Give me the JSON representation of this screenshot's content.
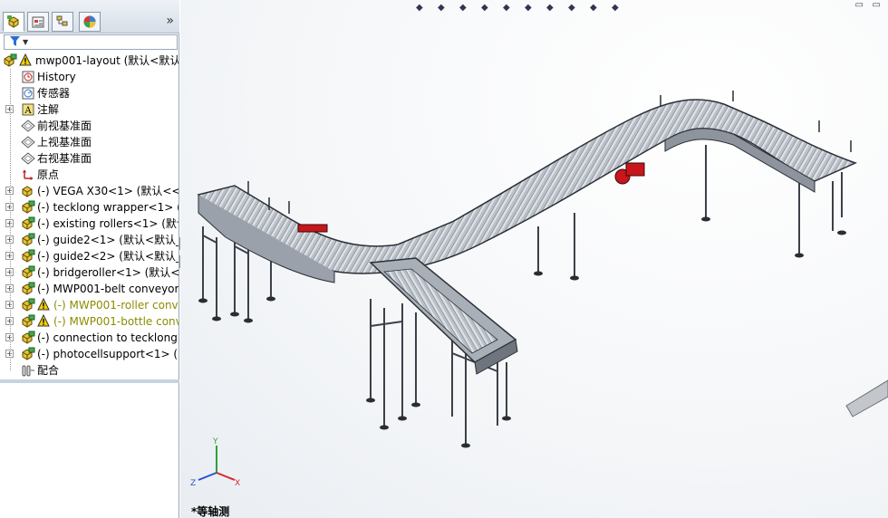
{
  "panel": {
    "tabs": [
      {
        "name": "feature-manager-tab",
        "icon": "feature-tree-icon"
      },
      {
        "name": "property-manager-tab",
        "icon": "property-icon"
      },
      {
        "name": "configuration-manager-tab",
        "icon": "configuration-icon"
      },
      {
        "name": "display-manager-tab",
        "icon": "display-manager-icon"
      }
    ],
    "more_tabs": "»",
    "filter_icon": "filter-icon"
  },
  "tree": [
    {
      "label": "mwp001-layout  (默认<默认",
      "icon": "assembly-icon",
      "level": 0,
      "expander": false,
      "warning": true,
      "warn_color": false
    },
    {
      "label": "History",
      "icon": "history-icon",
      "level": 1,
      "expander": false
    },
    {
      "label": "传感器",
      "icon": "sensor-icon",
      "level": 1,
      "expander": false
    },
    {
      "label": "注解",
      "icon": "annotation-icon",
      "level": 1,
      "expander": true
    },
    {
      "label": "前视基准面",
      "icon": "plane-icon",
      "level": 1,
      "expander": false
    },
    {
      "label": "上视基准面",
      "icon": "plane-icon",
      "level": 1,
      "expander": false
    },
    {
      "label": "右视基准面",
      "icon": "plane-icon",
      "level": 1,
      "expander": false
    },
    {
      "label": "原点",
      "icon": "origin-icon",
      "level": 1,
      "expander": false
    },
    {
      "label": "(-) VEGA X30<1> (默认<<默",
      "icon": "part-icon",
      "level": 1,
      "expander": true
    },
    {
      "label": "(-) tecklong wrapper<1> (",
      "icon": "subassembly-icon",
      "level": 1,
      "expander": true
    },
    {
      "label": "(-) existing rollers<1> (默认",
      "icon": "subassembly-icon",
      "level": 1,
      "expander": true
    },
    {
      "label": "(-) guide2<1> (默认<默认_",
      "icon": "subassembly-icon",
      "level": 1,
      "expander": true
    },
    {
      "label": "(-) guide2<2> (默认<默认_",
      "icon": "subassembly-icon",
      "level": 1,
      "expander": true
    },
    {
      "label": "(-) bridgeroller<1> (默认<",
      "icon": "subassembly-icon",
      "level": 1,
      "expander": true
    },
    {
      "label": "(-) MWP001-belt conveyor",
      "icon": "subassembly-icon",
      "level": 1,
      "expander": true
    },
    {
      "label": "(-) MWP001-roller conv",
      "icon": "subassembly-icon",
      "level": 1,
      "expander": true,
      "warning": true,
      "warn_color": true
    },
    {
      "label": "(-) MWP001-bottle conv",
      "icon": "subassembly-icon",
      "level": 1,
      "expander": true,
      "warning": true,
      "warn_color": true
    },
    {
      "label": "(-) connection to tecklong",
      "icon": "subassembly-icon",
      "level": 1,
      "expander": true
    },
    {
      "label": "(-) photocellsupport<1> (",
      "icon": "subassembly-icon",
      "level": 1,
      "expander": true
    },
    {
      "label": "配合",
      "icon": "mates-icon",
      "level": 1,
      "expander": false
    }
  ],
  "graphics": {
    "view_name": "*等轴测",
    "toolbar_icons": [
      "zoom-to-fit-icon",
      "zoom-area-icon",
      "previous-view-icon",
      "section-view-icon",
      "view-orientation-icon",
      "display-style-icon",
      "hide-show-icon",
      "edit-appearance-icon",
      "apply-scene-icon",
      "view-settings-icon"
    ],
    "axis_labels": {
      "x": "X",
      "y": "Y",
      "z": "Z"
    }
  }
}
